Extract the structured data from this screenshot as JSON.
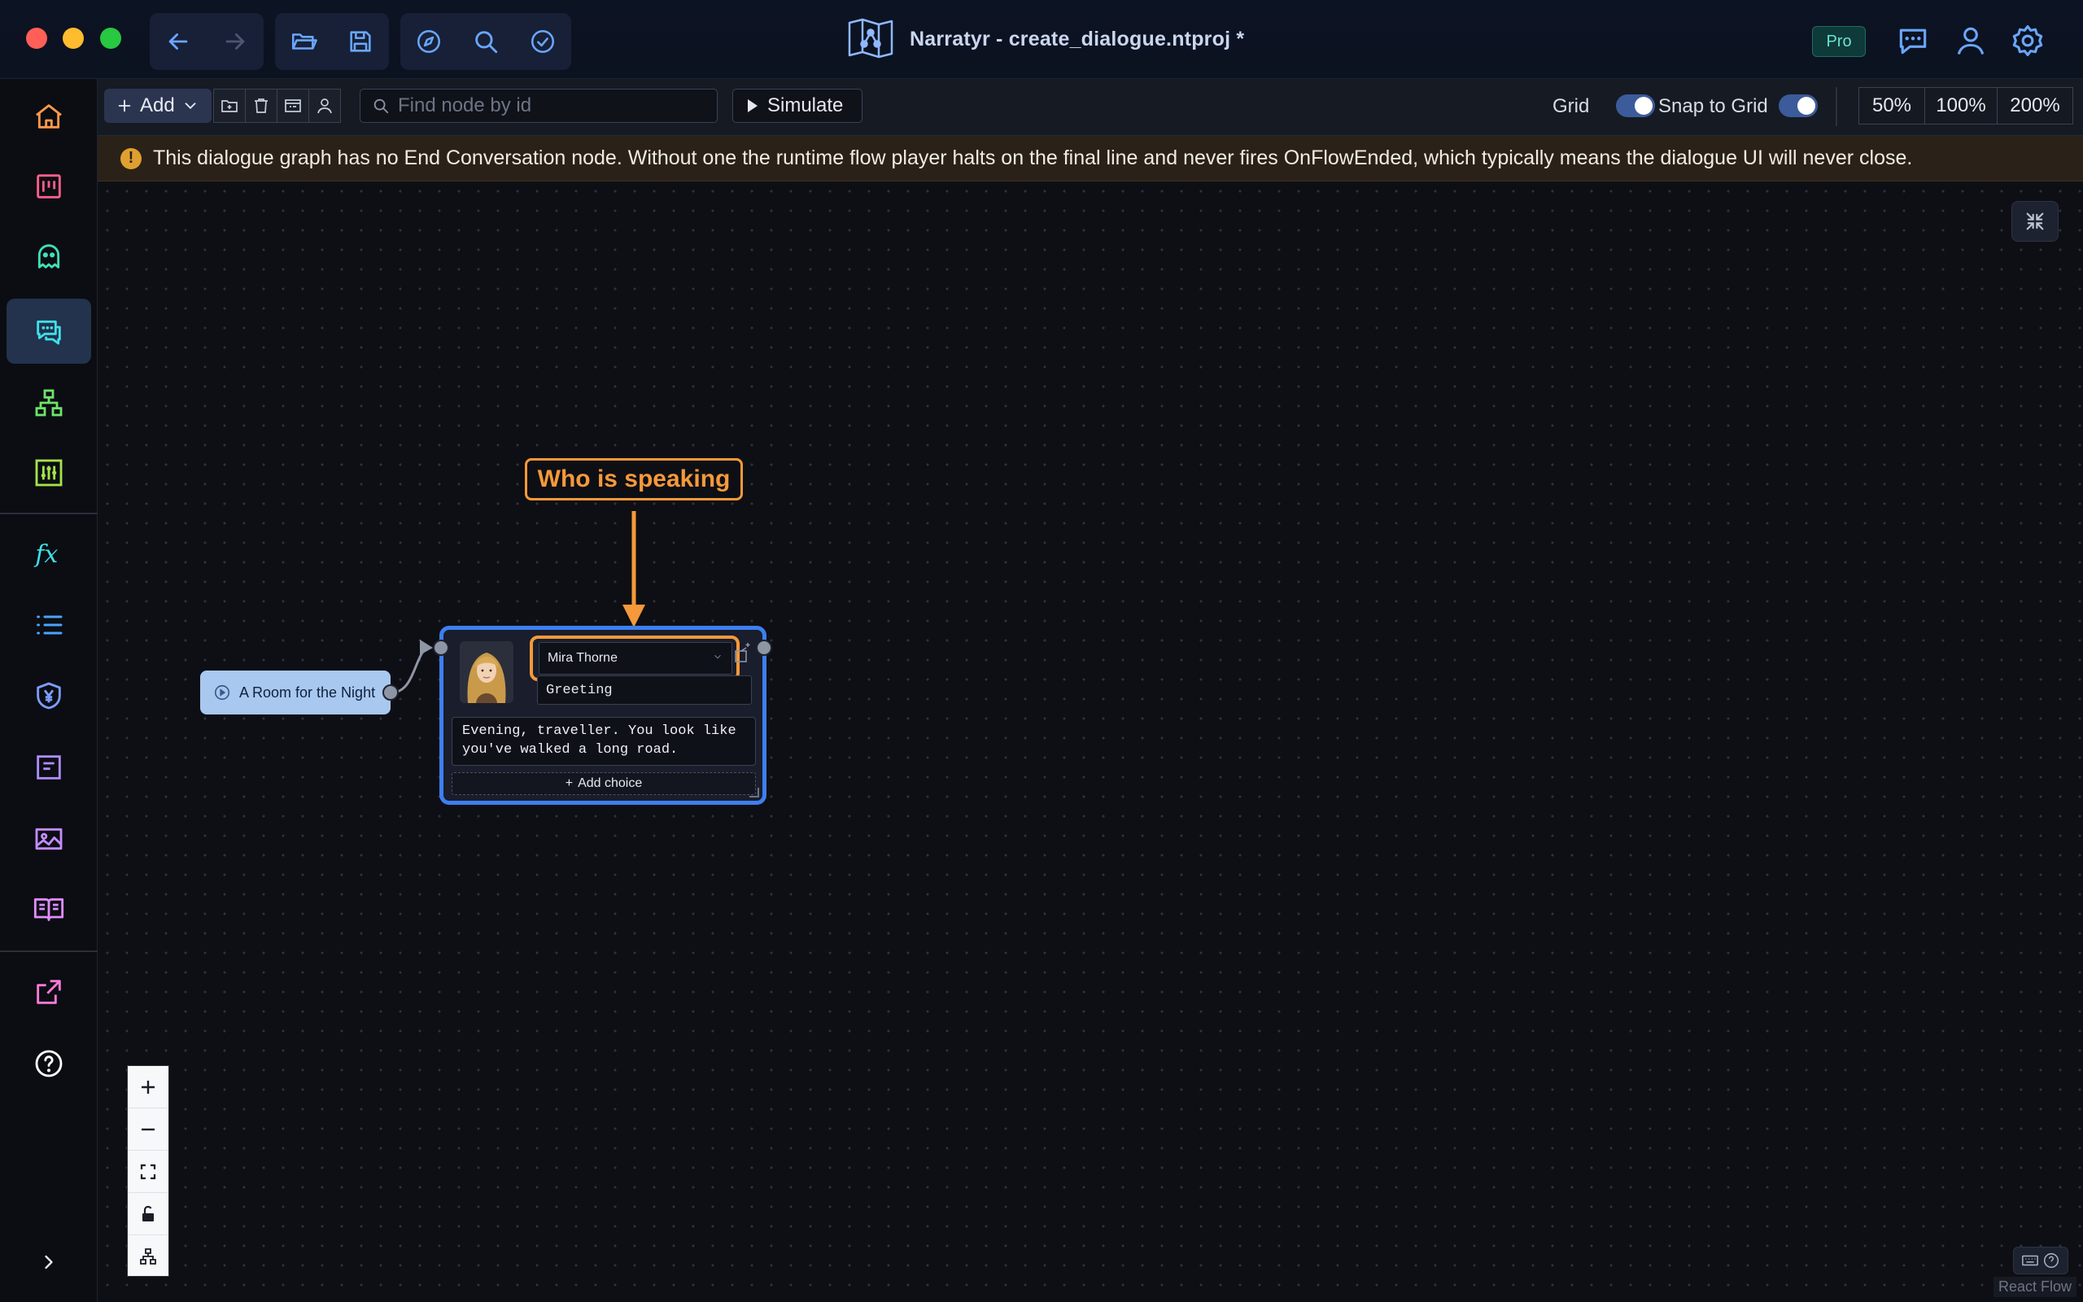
{
  "window": {
    "title": "Narratyr - create_dialogue.ntproj *",
    "badge": "Pro"
  },
  "titlebar": {
    "left_icons": [
      "back-arrow-icon",
      "forward-arrow-icon",
      "open-folder-icon",
      "save-icon",
      "compass-icon",
      "search-icon",
      "validate-check-icon"
    ],
    "right_icons": [
      "chat-icon",
      "user-icon",
      "settings-gear-icon"
    ]
  },
  "sidebar": {
    "items": [
      {
        "name": "home-icon",
        "active": false
      },
      {
        "name": "board-icon",
        "active": false
      },
      {
        "name": "ghost-characters-icon",
        "active": false
      },
      {
        "name": "dialogue-icon",
        "active": true
      },
      {
        "name": "hierarchy-icon",
        "active": false
      },
      {
        "name": "sliders-icon",
        "active": false
      },
      {
        "name": "function-icon",
        "active": false
      },
      {
        "name": "list-icon",
        "active": false
      },
      {
        "name": "currency-shield-icon",
        "active": false
      },
      {
        "name": "document-icon",
        "active": false
      },
      {
        "name": "image-icon",
        "active": false
      },
      {
        "name": "book-icon",
        "active": false
      },
      {
        "name": "export-icon",
        "active": false
      },
      {
        "name": "help-icon",
        "active": false
      }
    ],
    "expand_icon": "chevron-right-icon"
  },
  "toolbar": {
    "add_label": "Add",
    "search_placeholder": "Find node by id",
    "simulate_label": "Simulate",
    "grid_label": "Grid",
    "grid_on": true,
    "snap_label": "Snap to Grid",
    "snap_on": true,
    "zoom_levels": [
      "50%",
      "100%",
      "200%"
    ]
  },
  "warning": {
    "text": "This dialogue graph has no End Conversation node. Without one the runtime flow player halts on the final line and never fires OnFlowEnded, which typically means the dialogue UI will never close."
  },
  "canvas": {
    "callout": "Who is speaking",
    "start_node": {
      "label": "A Room for the Night"
    },
    "dialogue_node": {
      "speaker": "Mira Thorne",
      "title": "Greeting",
      "text_line1": "Evening, traveller. You look like",
      "text_line2": "you've walked a long road.",
      "add_choice": "Add choice"
    },
    "attribution": "React Flow"
  },
  "colors": {
    "accent": "#3d7ff0",
    "callout": "#f5993a",
    "warning": "#e0a030",
    "start_node": "#a8c8f0"
  }
}
